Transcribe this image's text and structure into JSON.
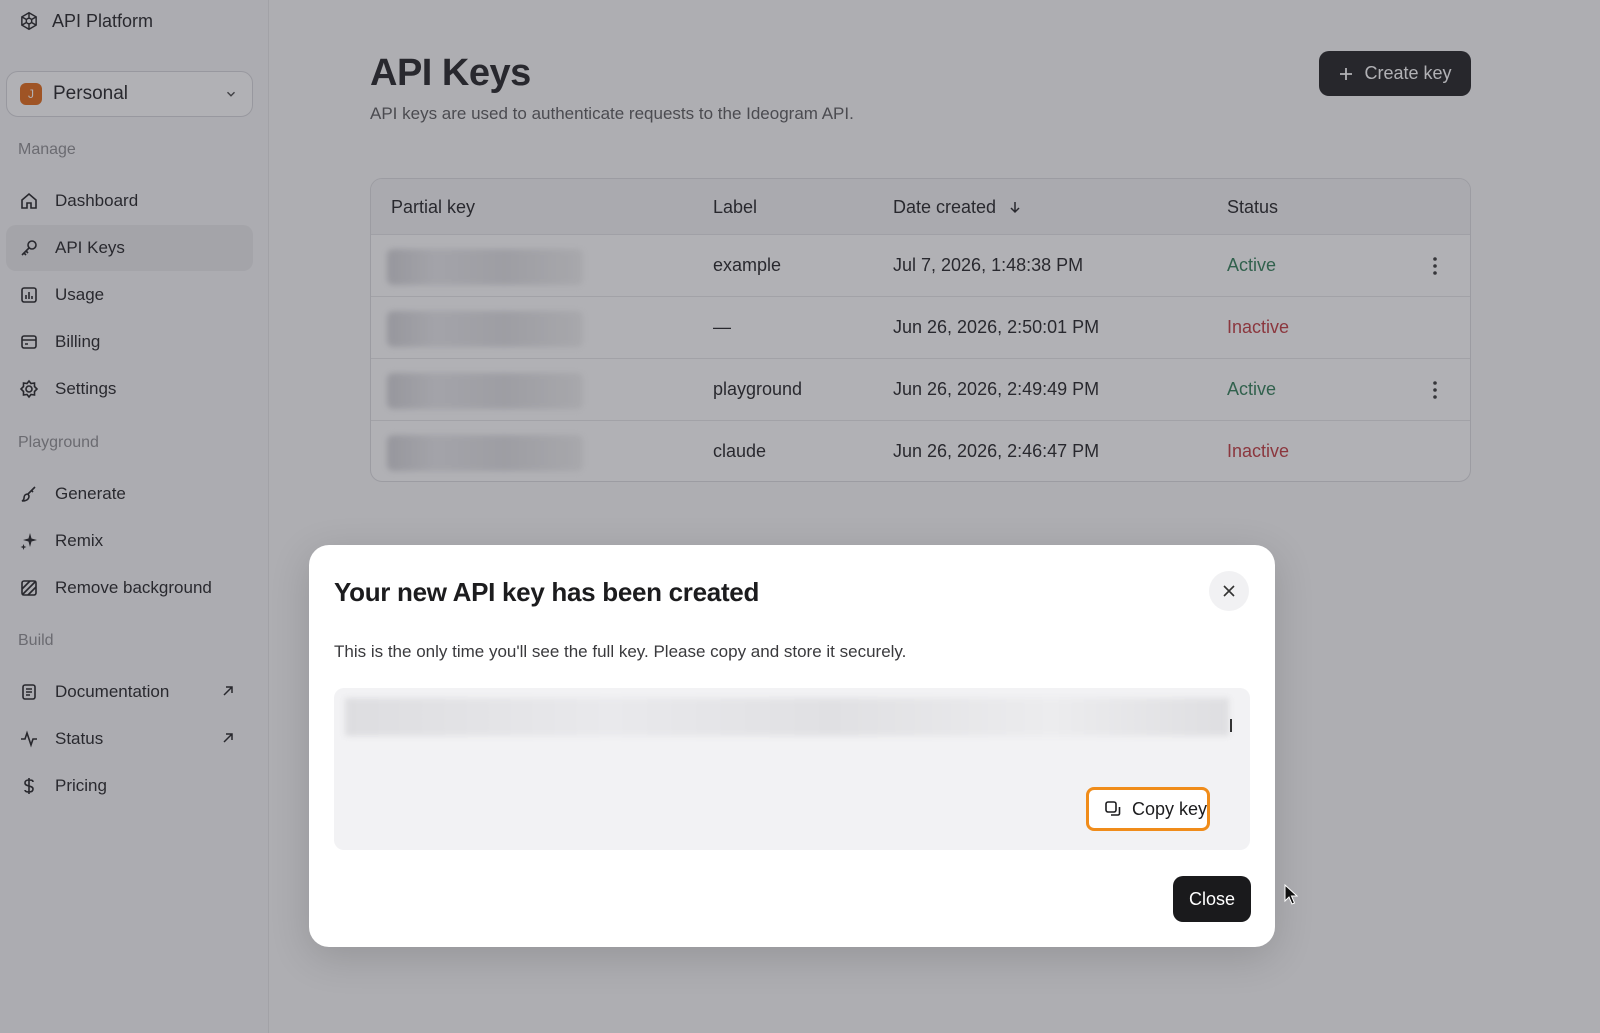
{
  "sidebar": {
    "brand": "API Platform",
    "workspace": {
      "avatar_letter": "J",
      "name": "Personal"
    },
    "sections": {
      "manage": "Manage",
      "playground": "Playground",
      "build": "Build"
    },
    "items": {
      "dashboard": "Dashboard",
      "api_keys": "API Keys",
      "usage": "Usage",
      "billing": "Billing",
      "settings": "Settings",
      "generate": "Generate",
      "remix": "Remix",
      "remove_background": "Remove background",
      "documentation": "Documentation",
      "status": "Status",
      "pricing": "Pricing"
    }
  },
  "main": {
    "title": "API Keys",
    "subtitle": "API keys are used to authenticate requests to the Ideogram API.",
    "create_label": "Create key",
    "table": {
      "headers": {
        "partial_key": "Partial key",
        "label": "Label",
        "date_created": "Date created",
        "status": "Status"
      },
      "rows": [
        {
          "label": "example",
          "date": "Jul 7, 2026, 1:48:38 PM",
          "status": "Active"
        },
        {
          "label": "—",
          "date": "Jun 26, 2026, 2:50:01 PM",
          "status": "Inactive"
        },
        {
          "label": "playground",
          "date": "Jun 26, 2026, 2:49:49 PM",
          "status": "Active"
        },
        {
          "label": "claude",
          "date": "Jun 26, 2026, 2:46:47 PM",
          "status": "Inactive"
        }
      ]
    }
  },
  "modal": {
    "title": "Your new API key has been created",
    "description": "This is the only time you'll see the full key. Please copy and store it securely.",
    "copy_label": "Copy key",
    "close_label": "Close"
  },
  "colors": {
    "active": "#2a7a52",
    "inactive": "#c0353a",
    "highlight": "#f08c1a",
    "primary_button": "#1a1a1c"
  }
}
